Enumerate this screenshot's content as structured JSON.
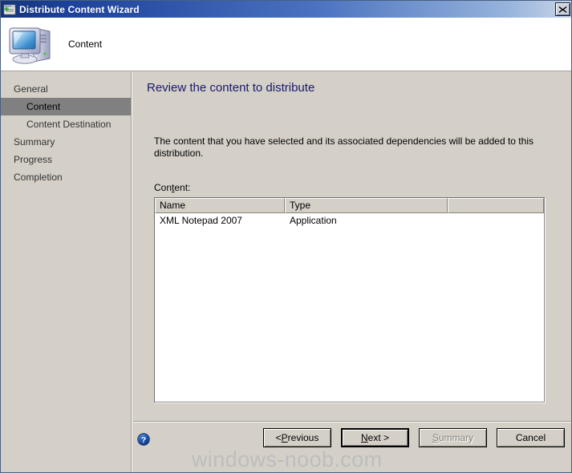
{
  "window": {
    "title": "Distribute Content Wizard",
    "title_icon": "wizard-window-plus-icon",
    "close_label": "✕"
  },
  "header": {
    "icon": "computer-monitor-icon",
    "label": "Content"
  },
  "sidebar": {
    "items": [
      {
        "label": "General",
        "level": 0,
        "selected": false
      },
      {
        "label": "Content",
        "level": 1,
        "selected": true
      },
      {
        "label": "Content Destination",
        "level": 1,
        "selected": false
      },
      {
        "label": "Summary",
        "level": 0,
        "selected": false
      },
      {
        "label": "Progress",
        "level": 0,
        "selected": false
      },
      {
        "label": "Completion",
        "level": 0,
        "selected": false
      }
    ]
  },
  "main": {
    "page_title": "Review the content to distribute",
    "description": "The content that you have selected and its associated dependencies will be added to this distribution.",
    "content_label_pre": "Con",
    "content_label_accel": "t",
    "content_label_post": "ent:",
    "list": {
      "columns": [
        "Name",
        "Type",
        ""
      ],
      "rows": [
        {
          "name": "XML Notepad 2007",
          "type": "Application",
          "extra": ""
        }
      ]
    }
  },
  "footer": {
    "help_icon": "help-question-icon",
    "buttons": [
      {
        "name": "previous",
        "pre": "< ",
        "accel": "P",
        "post": "revious",
        "disabled": false,
        "default": false
      },
      {
        "name": "next",
        "pre": "",
        "accel": "N",
        "post": "ext >",
        "disabled": false,
        "default": true
      },
      {
        "name": "summary",
        "pre": "",
        "accel": "S",
        "post": "ummary",
        "disabled": true,
        "default": false
      },
      {
        "name": "cancel",
        "pre": "",
        "accel": "",
        "post": "Cancel",
        "disabled": false,
        "default": false
      }
    ]
  },
  "watermark": {
    "text": "windows-noob.com"
  },
  "colors": {
    "dialog_face": "#d4d0c8",
    "title_start": "#14347c",
    "title_end": "#c8d4e8",
    "heading_blue": "#18186c",
    "selection_gray": "#808080",
    "watermark_gray": "#bdbdbd"
  }
}
